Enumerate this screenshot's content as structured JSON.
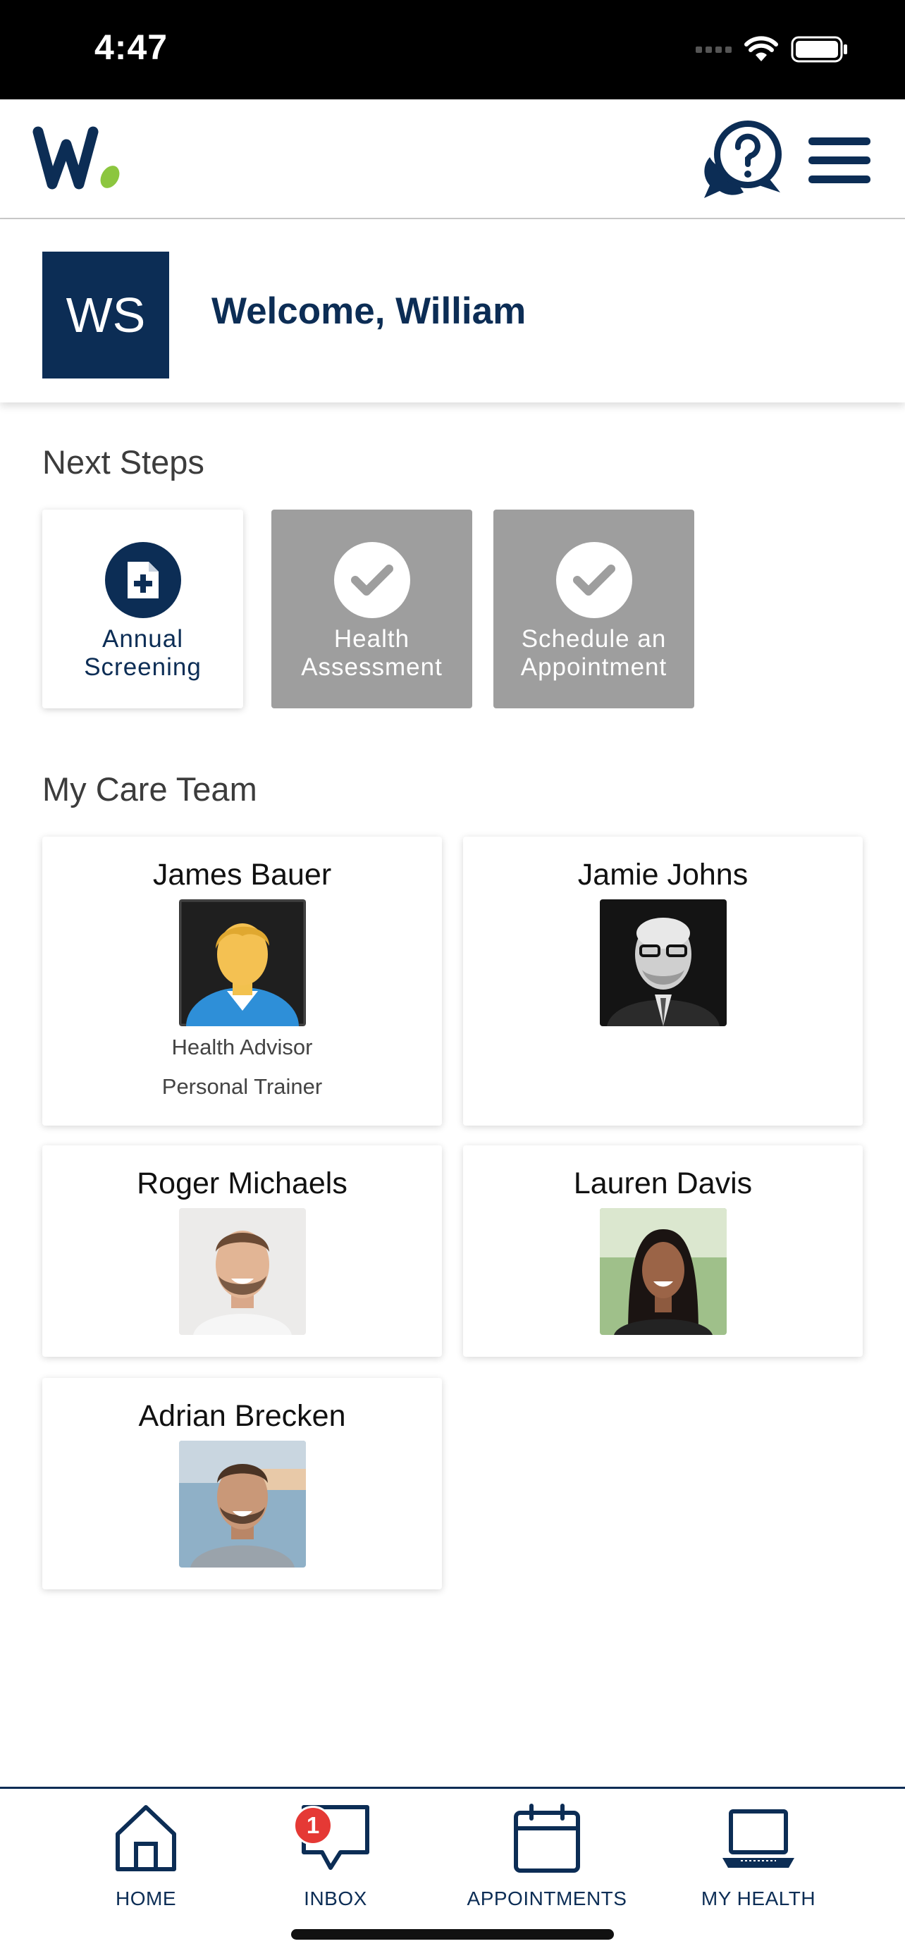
{
  "status_bar": {
    "time": "4:47"
  },
  "header": {
    "help_icon": "chat-question-icon",
    "menu_icon": "hamburger-icon"
  },
  "welcome": {
    "initials": "WS",
    "text": "Welcome, William"
  },
  "next_steps": {
    "title": "Next Steps",
    "items": [
      {
        "line1": "Annual",
        "line2": "Screening",
        "icon": "document-plus-icon",
        "state": "active"
      },
      {
        "line1": "Health",
        "line2": "Assessment",
        "icon": "check-icon",
        "state": "done"
      },
      {
        "line1": "Schedule an",
        "line2": "Appointment",
        "icon": "check-icon",
        "state": "done"
      }
    ]
  },
  "care_team": {
    "title": "My Care Team",
    "members": [
      {
        "name": "James Bauer",
        "roles": [
          "Health Advisor",
          "Personal Trainer"
        ]
      },
      {
        "name": "Jamie Johns",
        "roles": []
      },
      {
        "name": "Roger Michaels",
        "roles": []
      },
      {
        "name": "Lauren Davis",
        "roles": []
      },
      {
        "name": "Adrian Brecken",
        "roles": []
      }
    ]
  },
  "tabs": [
    {
      "label": "HOME",
      "icon": "home-icon"
    },
    {
      "label": "INBOX",
      "icon": "chat-bubble-icon",
      "badge": "1"
    },
    {
      "label": "APPOINTMENTS",
      "icon": "calendar-icon"
    },
    {
      "label": "MY HEALTH",
      "icon": "laptop-icon"
    }
  ],
  "colors": {
    "navy": "#0c2d55",
    "green": "#8cc63f",
    "gray_done": "#9e9e9e",
    "badge_red": "#e53935"
  }
}
